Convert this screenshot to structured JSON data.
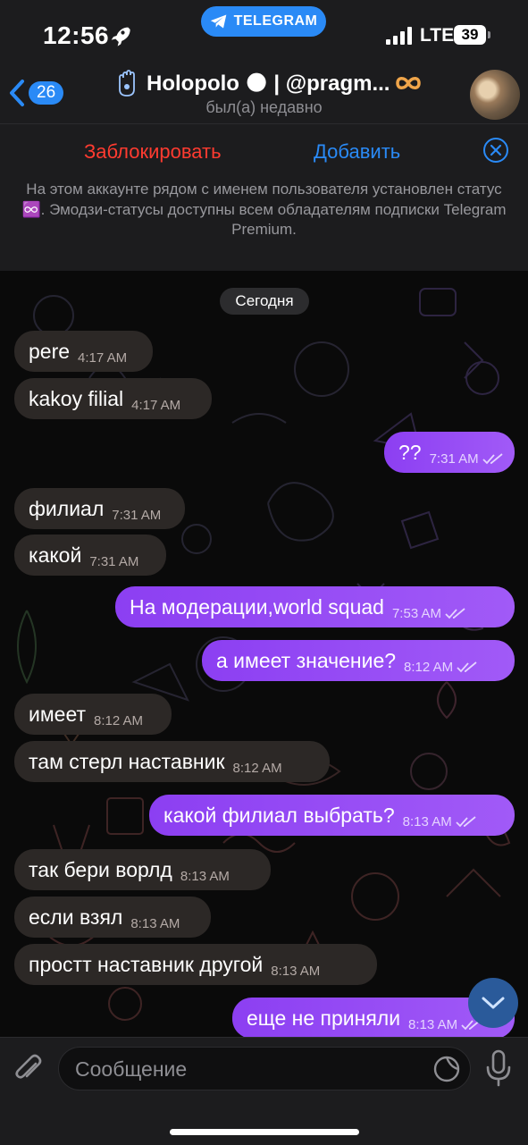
{
  "status_bar": {
    "time": "12:56",
    "pill_label": "TELEGRAM",
    "network": "LTE",
    "battery": "39"
  },
  "header": {
    "back_count": "26",
    "title": "Holopolo 🌑 | @pragm...",
    "subtitle": "был(а) недавно"
  },
  "banner": {
    "block_label": "Заблокировать",
    "add_label": "Добавить",
    "text": "На этом аккаунте рядом с именем пользователя установлен статус ♾️. Эмодзи-статусы доступны всем обладателям подписки Telegram Premium."
  },
  "chat": {
    "date_label": "Сегодня",
    "messages": [
      {
        "dir": "in",
        "text": "pere",
        "time": "4:17 AM"
      },
      {
        "dir": "in",
        "text": "kakoy filial",
        "time": "4:17 AM"
      },
      {
        "dir": "out",
        "text": "??",
        "time": "7:31 AM"
      },
      {
        "dir": "in",
        "text": "филиал",
        "time": "7:31 AM"
      },
      {
        "dir": "in",
        "text": "какой",
        "time": "7:31 AM"
      },
      {
        "dir": "out",
        "text": "На модерации,world squad",
        "time": "7:53 AM"
      },
      {
        "dir": "out",
        "text": "а имеет значение?",
        "time": "8:12 AM"
      },
      {
        "dir": "in",
        "text": "имеет",
        "time": "8:12 AM"
      },
      {
        "dir": "in",
        "text": "там стерл наставник",
        "time": "8:12 AM"
      },
      {
        "dir": "out",
        "text": "какой филиал выбрать?",
        "time": "8:13 AM"
      },
      {
        "dir": "in",
        "text": "так бери ворлд",
        "time": "8:13 AM"
      },
      {
        "dir": "in",
        "text": "если взял",
        "time": "8:13 AM"
      },
      {
        "dir": "in",
        "text": "простт наставник другой",
        "time": "8:13 AM"
      },
      {
        "dir": "out",
        "text": "еще не приняли",
        "time": "8:13 AM"
      }
    ]
  },
  "input": {
    "placeholder": "Сообщение"
  },
  "colors": {
    "accent": "#2a8af6",
    "danger": "#ff3b30",
    "outgoing": "#9b4ff5",
    "incoming": "#2c2826"
  }
}
